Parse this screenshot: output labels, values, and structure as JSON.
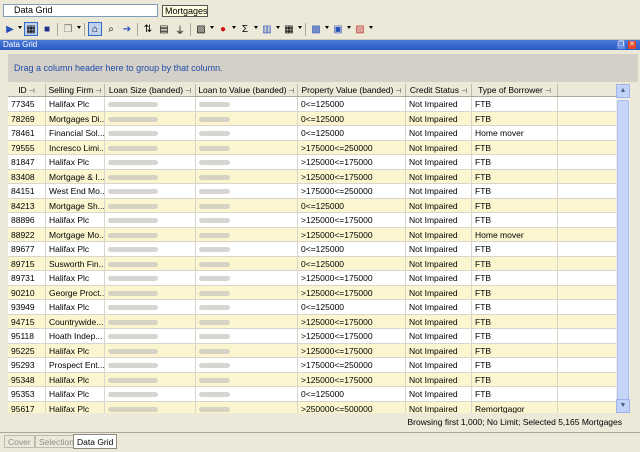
{
  "app": {
    "title_field": "Data Grid",
    "tooltip": "Mortgages"
  },
  "toolbar": {
    "icons": [
      "run-icon",
      "data-grid-view-icon",
      "save-icon",
      "copy-icon",
      "filter-by-selection-icon",
      "find-icon",
      "navigate-icon",
      "sort-icon",
      "group-icon",
      "filter-icon",
      "export-icon",
      "record-icon",
      "sum-icon",
      "columns-icon",
      "layout-icon",
      "chart-icon",
      "report-icon",
      "print-icon"
    ]
  },
  "panel": {
    "title": "Data Grid"
  },
  "group_zone": {
    "hint": "Drag a column header here to group by that column."
  },
  "grid": {
    "columns": [
      {
        "label": "ID"
      },
      {
        "label": "Selling Firm"
      },
      {
        "label": "Loan Size (banded)"
      },
      {
        "label": "Loan to Value (banded)"
      },
      {
        "label": "Property Value (banded)"
      },
      {
        "label": "Credit Status"
      },
      {
        "label": "Type of Borrower"
      }
    ],
    "rows": [
      {
        "id": "77345",
        "firm": "Halifax Plc",
        "property": "0<=125000",
        "credit": "Not Impaired",
        "borrower": "FTB"
      },
      {
        "id": "78269",
        "firm": "Mortgages Di...",
        "property": "0<=125000",
        "credit": "Not Impaired",
        "borrower": "FTB"
      },
      {
        "id": "78461",
        "firm": "Financial Sol...",
        "property": "0<=125000",
        "credit": "Not Impaired",
        "borrower": "Home mover"
      },
      {
        "id": "79555",
        "firm": "Incresco Limi...",
        "property": ">175000<=250000",
        "credit": "Not Impaired",
        "borrower": "FTB"
      },
      {
        "id": "81847",
        "firm": "Halifax Plc",
        "property": ">125000<=175000",
        "credit": "Not Impaired",
        "borrower": "FTB"
      },
      {
        "id": "83408",
        "firm": "Mortgage & I...",
        "property": ">125000<=175000",
        "credit": "Not Impaired",
        "borrower": "FTB"
      },
      {
        "id": "84151",
        "firm": "West End Mo...",
        "property": ">175000<=250000",
        "credit": "Not Impaired",
        "borrower": "FTB"
      },
      {
        "id": "84213",
        "firm": "Mortgage Sh...",
        "property": "0<=125000",
        "credit": "Not Impaired",
        "borrower": "FTB"
      },
      {
        "id": "88896",
        "firm": "Halifax Plc",
        "property": ">125000<=175000",
        "credit": "Not Impaired",
        "borrower": "FTB"
      },
      {
        "id": "88922",
        "firm": "Mortgage Mo...",
        "property": ">125000<=175000",
        "credit": "Not Impaired",
        "borrower": "Home mover"
      },
      {
        "id": "89677",
        "firm": "Halifax Plc",
        "property": "0<=125000",
        "credit": "Not Impaired",
        "borrower": "FTB"
      },
      {
        "id": "89715",
        "firm": "Susworth Fin...",
        "property": "0<=125000",
        "credit": "Not Impaired",
        "borrower": "FTB"
      },
      {
        "id": "89731",
        "firm": "Halifax Plc",
        "property": ">125000<=175000",
        "credit": "Not Impaired",
        "borrower": "FTB"
      },
      {
        "id": "90210",
        "firm": "George Proct...",
        "property": ">125000<=175000",
        "credit": "Not Impaired",
        "borrower": "FTB"
      },
      {
        "id": "93949",
        "firm": "Halifax Plc",
        "property": "0<=125000",
        "credit": "Not Impaired",
        "borrower": "FTB"
      },
      {
        "id": "94715",
        "firm": "Countrywide...",
        "property": ">125000<=175000",
        "credit": "Not Impaired",
        "borrower": "FTB"
      },
      {
        "id": "95118",
        "firm": "Hoath Indep...",
        "property": ">125000<=175000",
        "credit": "Not Impaired",
        "borrower": "FTB"
      },
      {
        "id": "95225",
        "firm": "Halifax Plc",
        "property": ">125000<=175000",
        "credit": "Not Impaired",
        "borrower": "FTB"
      },
      {
        "id": "95293",
        "firm": "Prospect Ent...",
        "property": ">175000<=250000",
        "credit": "Not Impaired",
        "borrower": "FTB"
      },
      {
        "id": "95348",
        "firm": "Halifax Plc",
        "property": ">125000<=175000",
        "credit": "Not Impaired",
        "borrower": "FTB"
      },
      {
        "id": "95353",
        "firm": "Halifax Plc",
        "property": "0<=125000",
        "credit": "Not Impaired",
        "borrower": "FTB"
      },
      {
        "id": "95617",
        "firm": "Halifax Plc",
        "property": ">250000<=500000",
        "credit": "Not Impaired",
        "borrower": "Remortgagor"
      }
    ]
  },
  "status": {
    "text": "Browsing first 1,000; No Limit; Selected 5,165 Mortgages"
  },
  "tabs": [
    {
      "label": "Cover",
      "active": false
    },
    {
      "label": "Selection",
      "active": false
    },
    {
      "label": "Data Grid",
      "active": true
    }
  ]
}
